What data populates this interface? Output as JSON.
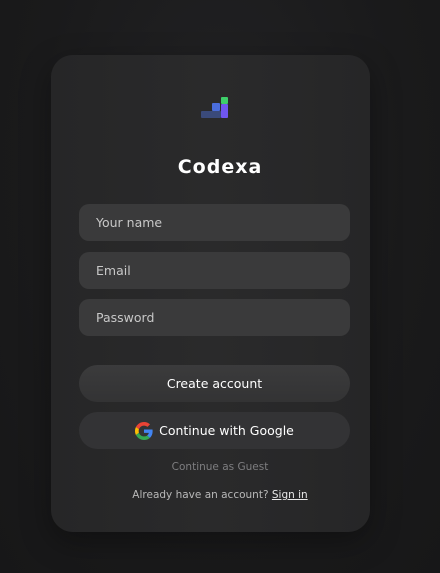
{
  "app": {
    "title": "Codexa",
    "logo_icon": "codexa-logo-icon",
    "accent_colors": [
      "#4a5bdc",
      "#6f56f0",
      "#3ecf6a",
      "#3a4a7a"
    ]
  },
  "form": {
    "name_placeholder": "Your name",
    "email_placeholder": "Email",
    "password_placeholder": "Password",
    "name_value": "",
    "email_value": "",
    "password_value": ""
  },
  "actions": {
    "create_label": "Create account",
    "google_label": "Continue with Google",
    "google_icon": "google-icon",
    "guest_label": "Continue as Guest"
  },
  "footer": {
    "prompt": "Already have an account? ",
    "signin_label": "Sign in"
  }
}
